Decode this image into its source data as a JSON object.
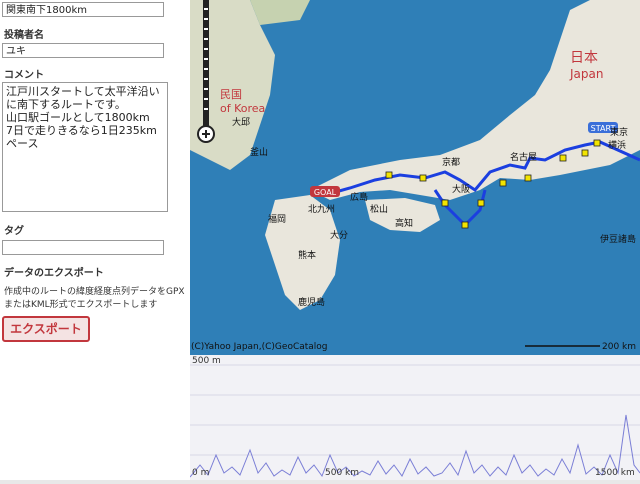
{
  "form": {
    "title_value": "関東南下1800km",
    "author_label": "投稿者名",
    "author_value": "ユキ",
    "comment_label": "コメント",
    "comment_value": "江戸川スタートして太平洋沿いに南下するルートです。\n山口駅ゴールとして1800km\n7日で走りきるなら1日235kmペース",
    "tag_label": "タグ",
    "tag_value": ""
  },
  "export": {
    "heading": "データのエクスポート",
    "desc_line1": "作成中のルートの緯度経度点列データをGPX",
    "desc_line2": "またはKML形式でエクスポートします",
    "button_label": "エクスポート"
  },
  "map": {
    "country_ja": "日本",
    "country_en": "Japan",
    "korea_ja": "民国",
    "korea_en": "of Korea",
    "cities": {
      "osaka": "大阪",
      "kyoto": "京都",
      "nagoya": "名古屋",
      "tokyo": "東京",
      "yokohama": "横浜",
      "hiroshima": "広島",
      "fukuoka": "福岡",
      "kumamoto": "熊本",
      "kagoshima": "鹿児島",
      "oita": "大分",
      "kochi": "高知",
      "matsuyama": "松山",
      "busan": "釜山",
      "daegu": "大邱",
      "izu": "伊豆諸島",
      "kitakyushu": "北九州"
    },
    "route_start_badge": "START",
    "route_goal_badge": "GOAL",
    "copyright": "(C)Yahoo Japan,(C)GeoCatalog",
    "scale_label": "200 km",
    "colors": {
      "sea": "#2f7fb7",
      "land": "#e9e6dc",
      "route": "#1b3fe0",
      "marker": "#f2e400"
    }
  },
  "elevation": {
    "y_top_label": "500 m",
    "y_bottom_label": "0 m",
    "x_mid_label": "500 km",
    "x_right_label": "1500 km"
  }
}
